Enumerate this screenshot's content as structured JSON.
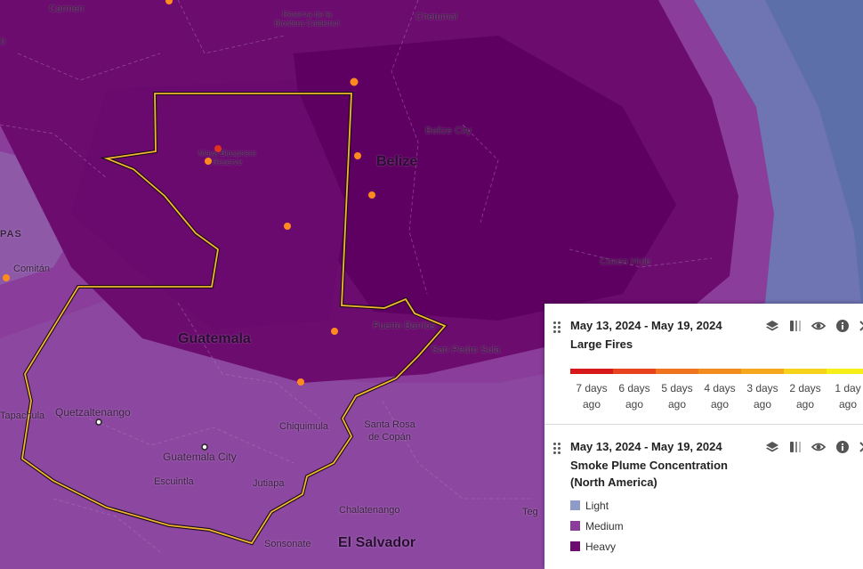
{
  "map": {
    "place_labels": [
      {
        "key": "carmen",
        "text": "Carmen"
      },
      {
        "key": "calakmul",
        "text": "Reserva de la Biosfera Calakmul"
      },
      {
        "key": "chetumal",
        "text": "Chetumal"
      },
      {
        "key": "belize_city",
        "text": "Belize City"
      },
      {
        "key": "maya",
        "text": "Maya Biosphere Reserve"
      },
      {
        "key": "comitan",
        "text": "Comitán"
      },
      {
        "key": "pas",
        "text": "PAS"
      },
      {
        "key": "coxen",
        "text": "Coxen Hole"
      },
      {
        "key": "puerto_barrios",
        "text": "Puerto Barrios"
      },
      {
        "key": "san_pedro",
        "text": "San Pedro Sula"
      },
      {
        "key": "tapachula",
        "text": "Tapachula"
      },
      {
        "key": "quetzaltenango",
        "text": "Quetzaltenango"
      },
      {
        "key": "guatemala_city",
        "text": "Guatemala City"
      },
      {
        "key": "chiquimula",
        "text": "Chiquimula"
      },
      {
        "key": "santa_rosa",
        "text": "Santa Rosa de Copán"
      },
      {
        "key": "escuintla",
        "text": "Escuintla"
      },
      {
        "key": "jutiapa",
        "text": "Jutiapa"
      },
      {
        "key": "chalatenango",
        "text": "Chalatenango"
      },
      {
        "key": "tegu",
        "text": "Teg"
      },
      {
        "key": "sonsonate",
        "text": "Sonsonate"
      }
    ],
    "country_labels": {
      "belize": "Belize",
      "guatemala": "Guatemala",
      "el_salvador": "El Salvador"
    },
    "edge_label": "0",
    "colors": {
      "smoke_light": "#8e9bc9",
      "smoke_medium": "#8a3d9a",
      "smoke_heavy": "#6b0c6e",
      "highlight_border": "#f2b630",
      "fire_orange": "#ff8a1f",
      "fire_red": "#e0301e"
    }
  },
  "panel": {
    "fires_layer": {
      "date_range": "May 13, 2024 - May 19, 2024",
      "title": "Large Fires",
      "scale": [
        {
          "label": "7 days ago",
          "color": "#d7191c"
        },
        {
          "label": "6 days ago",
          "color": "#e8431f"
        },
        {
          "label": "5 days ago",
          "color": "#f0731f"
        },
        {
          "label": "4 days ago",
          "color": "#f28c1f"
        },
        {
          "label": "3 days ago",
          "color": "#f5a81d"
        },
        {
          "label": "2 days ago",
          "color": "#f7d21a"
        },
        {
          "label": "1 day ago",
          "color": "#f7ef1a"
        }
      ]
    },
    "smoke_layer": {
      "date_range": "May 13, 2024 - May 19, 2024",
      "title_line1": "Smoke Plume Concentration",
      "title_line2": "(North America)",
      "legend": [
        {
          "label": "Light",
          "color": "#8e9bc9"
        },
        {
          "label": "Medium",
          "color": "#8a3d9a"
        },
        {
          "label": "Heavy",
          "color": "#6b0c6e"
        }
      ]
    },
    "tools": [
      "layers-icon",
      "compare-icon",
      "eye-icon",
      "info-icon",
      "close-icon"
    ]
  }
}
